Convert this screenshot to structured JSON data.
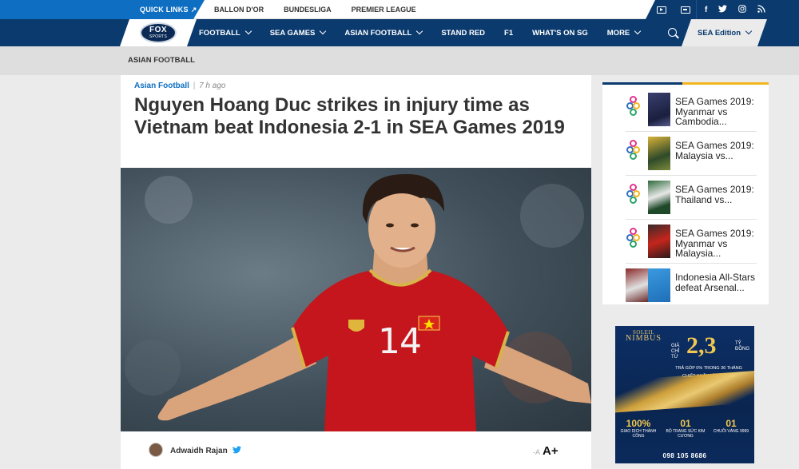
{
  "topbar": {
    "quick_links": "QUICK LINKS",
    "links": [
      "BALLON D'OR",
      "BUNDESLIGA",
      "PREMIER LEAGUE"
    ],
    "social": [
      "f",
      "t",
      "ig",
      "rss"
    ]
  },
  "nav": {
    "logo_fox": "FOX",
    "logo_sports": "SPORTS",
    "items": [
      {
        "label": "FOOTBALL",
        "dropdown": true
      },
      {
        "label": "SEA GAMES",
        "dropdown": true
      },
      {
        "label": "ASIAN FOOTBALL",
        "dropdown": true
      },
      {
        "label": "STAND RED",
        "dropdown": false
      },
      {
        "label": "F1",
        "dropdown": false
      },
      {
        "label": "WHAT'S ON SG",
        "dropdown": false
      },
      {
        "label": "MORE",
        "dropdown": true
      }
    ],
    "edition": "SEA Edition"
  },
  "breadcrumb": "ASIAN FOOTBALL",
  "article": {
    "category": "Asian Football",
    "separator": "|",
    "time_ago": "7 h ago",
    "headline": "Nguyen Hoang Duc strikes in injury time as Vietnam beat Indonesia 2-1 in SEA Games 2019",
    "jersey_number": "14",
    "author": "Adwaidh Rajan",
    "font_small": "-A",
    "font_large": "A+"
  },
  "sidebar": {
    "items": [
      {
        "title": "SEA Games 2019: Myanmar vs Cambodia..."
      },
      {
        "title": "SEA Games 2019: Malaysia vs..."
      },
      {
        "title": "SEA Games 2019: Thailand vs..."
      },
      {
        "title": "SEA Games 2019: Myanmar vs Malaysia..."
      },
      {
        "title": "Indonesia All-Stars defeat Arsenal..."
      }
    ]
  },
  "ad": {
    "brand_top": "SOLEIL",
    "brand_name": "NIMBUS",
    "price_label": "GIÁ CHỈ TỪ",
    "price": "2,3",
    "price_unit": "TỶ ĐỒNG",
    "line1": "TRẢ GÓP 0% TRONG 36 THÁNG",
    "line2": "CHIẾT KHẤU LÊN TỚI 6%",
    "stat1_value": "100%",
    "stat1_text": "GIAO DỊCH THÀNH CÔNG",
    "stat2_value": "01",
    "stat2_text": "BỘ TRANG SỨC KIM CƯƠNG",
    "stat3_value": "01",
    "stat3_text": "CHUỖI VÀNG 9999",
    "phone": "098 105 8686"
  },
  "colors": {
    "nav_bg": "#0a3a6e",
    "accent_blue": "#0d6ec2",
    "accent_gold": "#f2b51c",
    "jersey_red": "#c4161c"
  }
}
